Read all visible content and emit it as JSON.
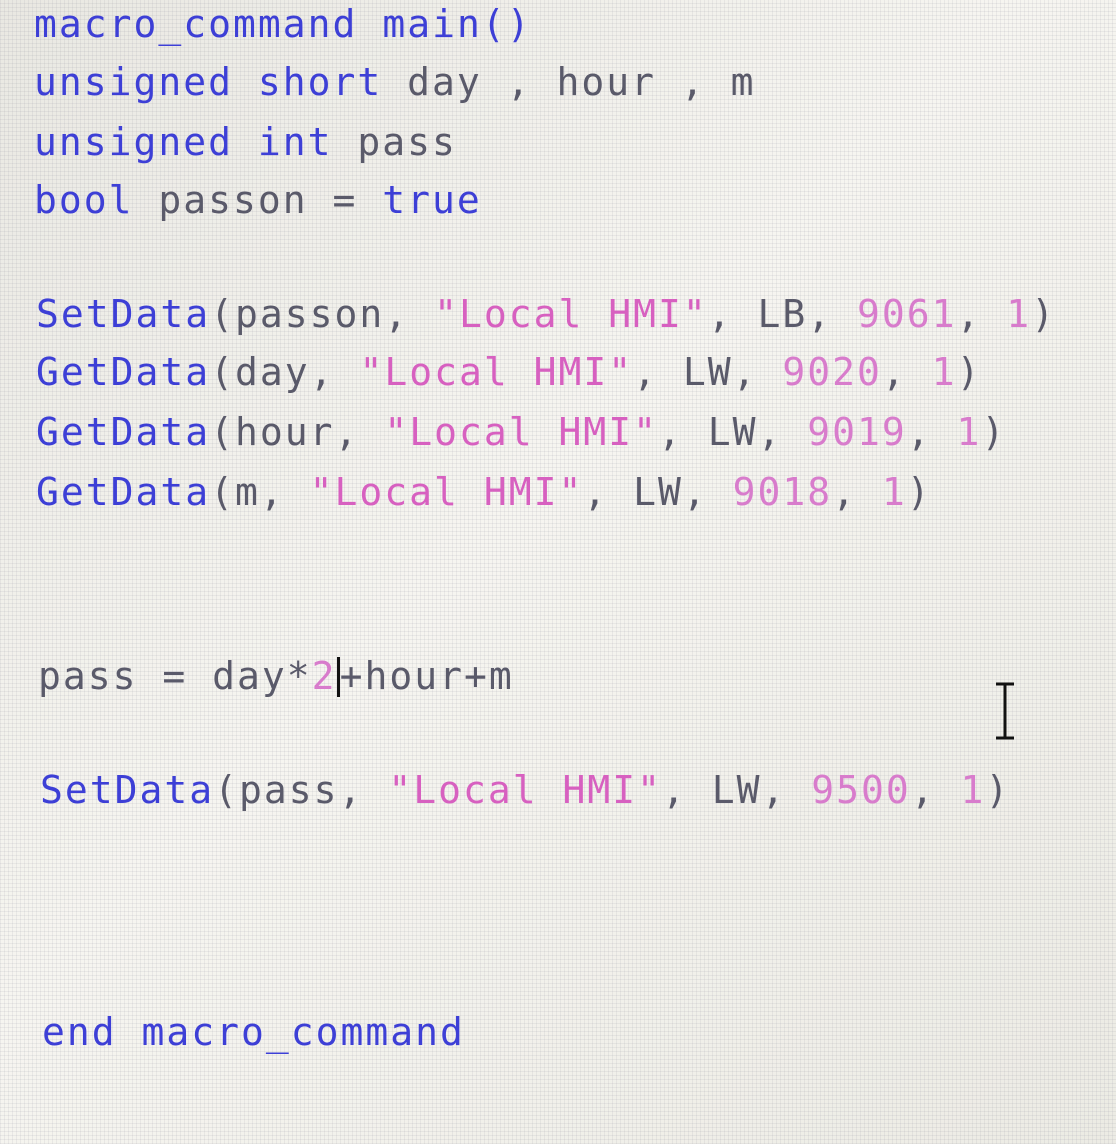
{
  "editor": {
    "lines": [
      {
        "id": "l1",
        "tokens": [
          {
            "t": "macro_command",
            "c": "kw"
          },
          {
            "t": " ",
            "c": "pl"
          },
          {
            "t": "main()",
            "c": "kw"
          }
        ]
      },
      {
        "id": "l2",
        "tokens": [
          {
            "t": "unsigned short",
            "c": "kw"
          },
          {
            "t": " day , hour , m",
            "c": "pl"
          }
        ]
      },
      {
        "id": "l3",
        "tokens": [
          {
            "t": "unsigned int",
            "c": "kw"
          },
          {
            "t": " pass",
            "c": "pl"
          }
        ]
      },
      {
        "id": "l4",
        "tokens": [
          {
            "t": "bool",
            "c": "kw"
          },
          {
            "t": " passon = ",
            "c": "pl"
          },
          {
            "t": "true",
            "c": "kw"
          }
        ]
      },
      {
        "id": "l5",
        "tokens": [
          {
            "t": "SetData",
            "c": "kw"
          },
          {
            "t": "(passon, ",
            "c": "pl"
          },
          {
            "t": "\"Local HMI\"",
            "c": "str"
          },
          {
            "t": ", LB, ",
            "c": "pl"
          },
          {
            "t": "9061",
            "c": "num"
          },
          {
            "t": ", ",
            "c": "pl"
          },
          {
            "t": "1",
            "c": "num"
          },
          {
            "t": ")",
            "c": "pl"
          }
        ]
      },
      {
        "id": "l6",
        "tokens": [
          {
            "t": "GetData",
            "c": "kw"
          },
          {
            "t": "(day, ",
            "c": "pl"
          },
          {
            "t": "\"Local HMI\"",
            "c": "str"
          },
          {
            "t": ", LW, ",
            "c": "pl"
          },
          {
            "t": "9020",
            "c": "num"
          },
          {
            "t": ", ",
            "c": "pl"
          },
          {
            "t": "1",
            "c": "num"
          },
          {
            "t": ")",
            "c": "pl"
          }
        ]
      },
      {
        "id": "l7",
        "tokens": [
          {
            "t": "GetData",
            "c": "kw"
          },
          {
            "t": "(hour, ",
            "c": "pl"
          },
          {
            "t": "\"Local HMI\"",
            "c": "str"
          },
          {
            "t": ", LW, ",
            "c": "pl"
          },
          {
            "t": "9019",
            "c": "num"
          },
          {
            "t": ", ",
            "c": "pl"
          },
          {
            "t": "1",
            "c": "num"
          },
          {
            "t": ")",
            "c": "pl"
          }
        ]
      },
      {
        "id": "l8",
        "tokens": [
          {
            "t": "GetData",
            "c": "kw"
          },
          {
            "t": "(m, ",
            "c": "pl"
          },
          {
            "t": "\"Local HMI\"",
            "c": "str"
          },
          {
            "t": ", LW, ",
            "c": "pl"
          },
          {
            "t": "9018",
            "c": "num"
          },
          {
            "t": ", ",
            "c": "pl"
          },
          {
            "t": "1",
            "c": "num"
          },
          {
            "t": ")",
            "c": "pl"
          }
        ]
      },
      {
        "id": "l9",
        "tokens": [
          {
            "t": "pass = day*",
            "c": "pl"
          },
          {
            "t": "2",
            "c": "num"
          },
          {
            "t": "|",
            "c": "caret"
          },
          {
            "t": "+hour+m",
            "c": "pl"
          }
        ]
      },
      {
        "id": "l10",
        "tokens": [
          {
            "t": "SetData",
            "c": "kw"
          },
          {
            "t": "(pass, ",
            "c": "pl"
          },
          {
            "t": "\"Local HMI\"",
            "c": "str"
          },
          {
            "t": ", LW, ",
            "c": "pl"
          },
          {
            "t": "9500",
            "c": "num"
          },
          {
            "t": ", ",
            "c": "pl"
          },
          {
            "t": "1",
            "c": "num"
          },
          {
            "t": ")",
            "c": "pl"
          }
        ]
      },
      {
        "id": "l11",
        "tokens": [
          {
            "t": "end macro_command",
            "c": "kw"
          }
        ]
      }
    ]
  }
}
